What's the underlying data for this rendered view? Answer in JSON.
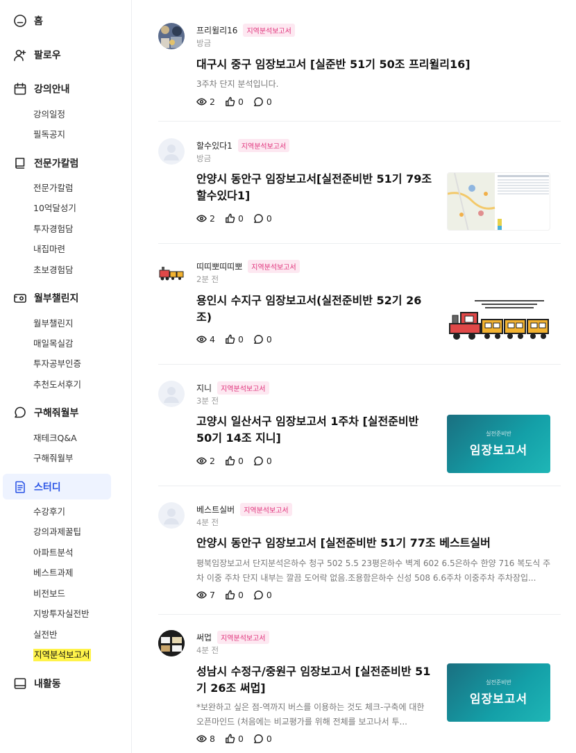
{
  "sidebar": {
    "home": "홈",
    "follow": "팔로우",
    "lecture": "강의안내",
    "lecture_items": [
      "강의일정",
      "필독공지"
    ],
    "column": "전문가칼럼",
    "column_items": [
      "전문가칼럼",
      "10억달성기",
      "투자경험담",
      "내집마련",
      "초보경험담"
    ],
    "challenge": "월부챌린지",
    "challenge_items": [
      "월부챌린지",
      "매일목실감",
      "투자공부인증",
      "추천도서후기"
    ],
    "help": "구해줘월부",
    "help_items": [
      "재테크Q&A",
      "구해줘월부"
    ],
    "study": "스터디",
    "study_items": [
      "수강후기",
      "강의과제꿀팁",
      "아파트분석",
      "베스트과제",
      "비전보드",
      "지방투자실전반",
      "실전반",
      "지역분석보고서"
    ],
    "my": "내활동"
  },
  "posts": [
    {
      "author": "프리윌리16",
      "badge": "지역분석보고서",
      "time": "방금",
      "title": "대구시 중구 임장보고서 [실준반 51기 50조 프리윌리16]",
      "snippet": "3주차 단지 분석입니다.",
      "views": "2",
      "likes": "0",
      "comments": "0"
    },
    {
      "author": "할수있다1",
      "badge": "지역분석보고서",
      "time": "방금",
      "title": "안양시 동안구 임장보고서[실전준비반 51기 79조 할수있다1]",
      "views": "2",
      "likes": "0",
      "comments": "0"
    },
    {
      "author": "띠띠뽀띠띠뽀",
      "badge": "지역분석보고서",
      "time": "2분 전",
      "title": "용인시 수지구 임장보고서(실전준비반 52기 26조)",
      "views": "4",
      "likes": "0",
      "comments": "0"
    },
    {
      "author": "지니",
      "badge": "지역분석보고서",
      "time": "3분 전",
      "title": "고양시 일산서구 임장보고서 1주차 [실전준비반 50기 14조 지니]",
      "thumb_small": "실전준비반",
      "thumb_text": "임장보고서",
      "views": "2",
      "likes": "0",
      "comments": "0"
    },
    {
      "author": "베스트실버",
      "badge": "지역분석보고서",
      "time": "4분 전",
      "title": "안양시 동안구 임장보고서 [실전준비반 51기 77조 베스트실버",
      "snippet": "평북임장보고서 단지분석은하수 청구 502 5.5 23평은하수 벽계 602 6.5은하수 한양 716 복도식 주차 이중 주차 단지 내부는 깔끔 도어락 없음.조용함은하수 신성 508 6.6주차 이중주차 주차장입...",
      "views": "7",
      "likes": "0",
      "comments": "0"
    },
    {
      "author": "써멉",
      "badge": "지역분석보고서",
      "time": "4분 전",
      "title": "성남시 수정구/중원구 임장보고서 [실전준비반 51기 26조 써멉]",
      "snippet": "*보완하고 싶은 점-역까지 버스를 이용하는 것도 체크-구축에 대한 오픈마인드 (처음에는 비교평가를 위해 전체를 보고나서 투...",
      "thumb_small": "실전준비반",
      "thumb_text": "임장보고서",
      "views": "8",
      "likes": "0",
      "comments": "0"
    }
  ]
}
